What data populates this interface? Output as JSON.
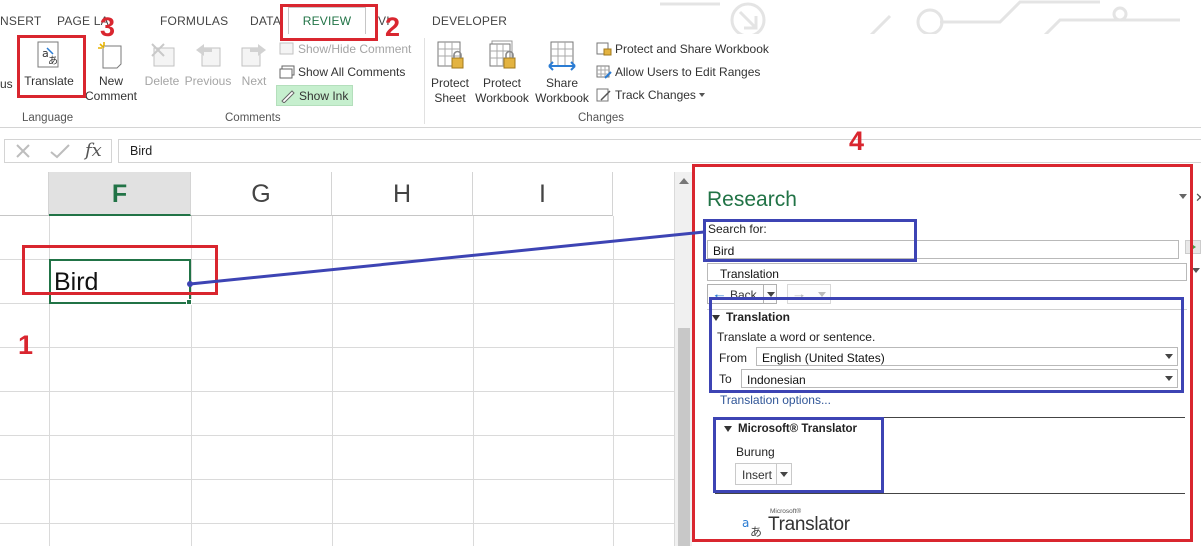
{
  "tabs": [
    "NSERT",
    "PAGE LA",
    "FORMULAS",
    "DATA",
    "REVIEW",
    "VI",
    "DEVELOPER"
  ],
  "ribbon": {
    "partial_label": "us",
    "translate": "Translate",
    "new_comment": [
      "New",
      "Comment"
    ],
    "delete": "Delete",
    "previous": "Previous",
    "next": "Next",
    "show_hide_comment": "Show/Hide Comment",
    "show_all_comments": "Show All Comments",
    "show_ink": "Show Ink",
    "protect_sheet": [
      "Protect",
      "Sheet"
    ],
    "protect_workbook": [
      "Protect",
      "Workbook"
    ],
    "share_workbook": [
      "Share",
      "Workbook"
    ],
    "protect_and_share": "Protect and Share Workbook",
    "allow_users": "Allow Users to Edit Ranges",
    "track_changes": "Track Changes",
    "groups": {
      "language": "Language",
      "comments": "Comments",
      "changes": "Changes"
    }
  },
  "formula_bar": {
    "fx": "fx",
    "value": "Bird"
  },
  "grid": {
    "columns": [
      "F",
      "G",
      "H",
      "I"
    ],
    "selected_cell_value": "Bird"
  },
  "research": {
    "title": "Research",
    "search_label": "Search for:",
    "search_value": "Bird",
    "source": "Translation",
    "back": "Back",
    "section": "Translation",
    "instruction": "Translate a word or sentence.",
    "from_label": "From",
    "from_value": "English (United States)",
    "to_label": "To",
    "to_value": "Indonesian",
    "options_link": "Translation options...",
    "provider": "Microsoft® Translator",
    "result": "Burung",
    "insert": "Insert",
    "logo_small": "Microsoft®",
    "logo_text": "Translator"
  },
  "annotations": {
    "n1": "1",
    "n2": "2",
    "n3": "3",
    "n4": "4"
  },
  "colors": {
    "excel_green": "#217346",
    "annotation_red": "#d9262f",
    "annotation_blue": "#3d44b4",
    "show_ink_bg": "#c6efce"
  }
}
